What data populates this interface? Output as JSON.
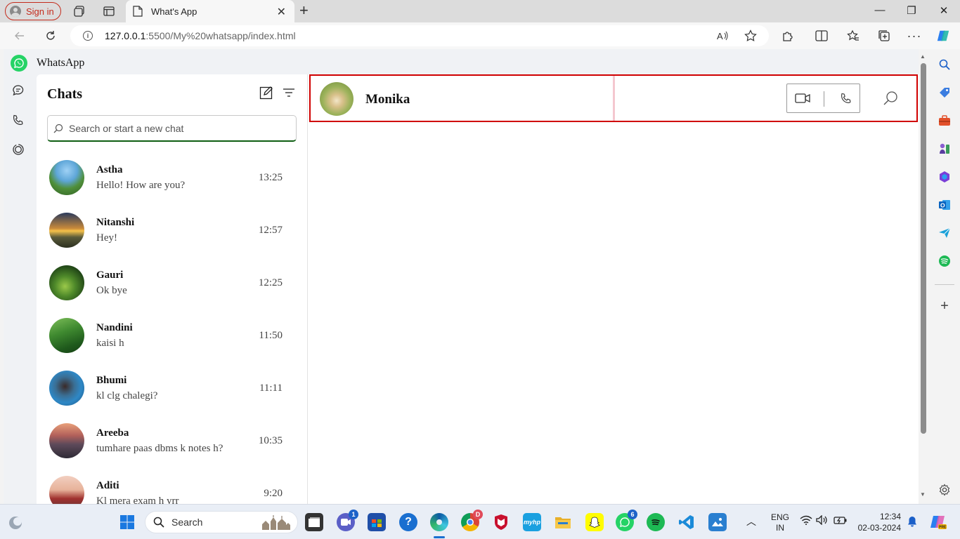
{
  "browser": {
    "signin_label": "Sign in",
    "tab_title": "What's App",
    "url_host": "127.0.0.1",
    "url_path": ":5500/My%20whatsapp/index.html"
  },
  "app": {
    "title": "WhatsApp",
    "brand_color": "#25d366"
  },
  "chat_panel": {
    "title": "Chats",
    "search_placeholder": "Search or start a new chat",
    "chats": [
      {
        "name": "Astha",
        "message": "Hello! How are you?",
        "time": "13:25"
      },
      {
        "name": "Nitanshi",
        "message": "Hey!",
        "time": "12:57"
      },
      {
        "name": "Gauri",
        "message": "Ok bye",
        "time": "12:25"
      },
      {
        "name": "Nandini",
        "message": "kaisi h",
        "time": "11:50"
      },
      {
        "name": "Bhumi",
        "message": "kl clg chalegi?",
        "time": "11:11"
      },
      {
        "name": "Areeba",
        "message": "tumhare paas dbms k notes h?",
        "time": "10:35"
      },
      {
        "name": "Aditi",
        "message": "Kl mera exam h yrr",
        "time": "9:20"
      }
    ]
  },
  "conversation": {
    "contact_name": "Monika"
  },
  "taskbar": {
    "search_label": "Search",
    "teams_badge": "1",
    "chrome_badge": "D",
    "whatsapp_badge": "6",
    "lang_line1": "ENG",
    "lang_line2": "IN",
    "time": "12:34",
    "date": "02-03-2024"
  }
}
